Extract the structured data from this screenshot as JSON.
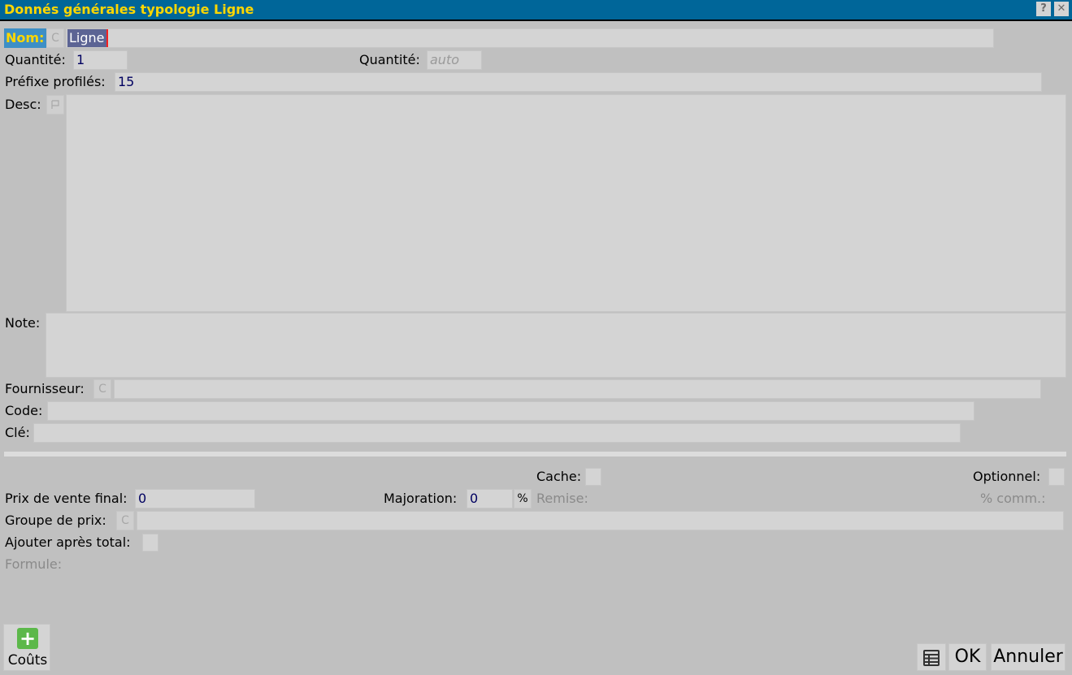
{
  "window": {
    "title": "Donnés générales typologie Ligne",
    "help_label": "?",
    "close_label": "✕"
  },
  "form": {
    "nom_label": "Nom:",
    "nom_value": "Ligne",
    "c_label": "C",
    "quantite_label": "Quantité:",
    "quantite_value": "1",
    "quantite2_label": "Quantité:",
    "quantite2_placeholder": "auto",
    "prefixe_label": "Préfixe profilés:",
    "prefixe_value": "15",
    "desc_label": "Desc:",
    "note_label": "Note:",
    "fournisseur_label": "Fournisseur:",
    "code_label": "Code:",
    "cle_label": "Clé:"
  },
  "pricing": {
    "cache_label": "Cache:",
    "optionnel_label": "Optionnel:",
    "prix_label": "Prix de vente final:",
    "prix_value": "0",
    "majoration_label": "Majoration:",
    "majoration_value": "0",
    "percent_label": "%",
    "remise_label": "Remise:",
    "comm_label": "% comm.:",
    "groupe_label": "Groupe de prix:",
    "ajouter_label": "Ajouter après total:",
    "formule_label": "Formule:"
  },
  "buttons": {
    "couts_label": "Coûts",
    "ok_label": "OK",
    "annuler_label": "Annuler"
  },
  "icons": {
    "flag": "flag-icon",
    "plus": "plus-icon",
    "table": "table-icon"
  },
  "colors": {
    "titlebar_bg": "#006699",
    "title_text": "#ffd700",
    "background": "#c0c0c0",
    "field_bg": "#d4d4d4",
    "value_text": "#000060",
    "focus_label_bg": "#3d8fc6"
  }
}
